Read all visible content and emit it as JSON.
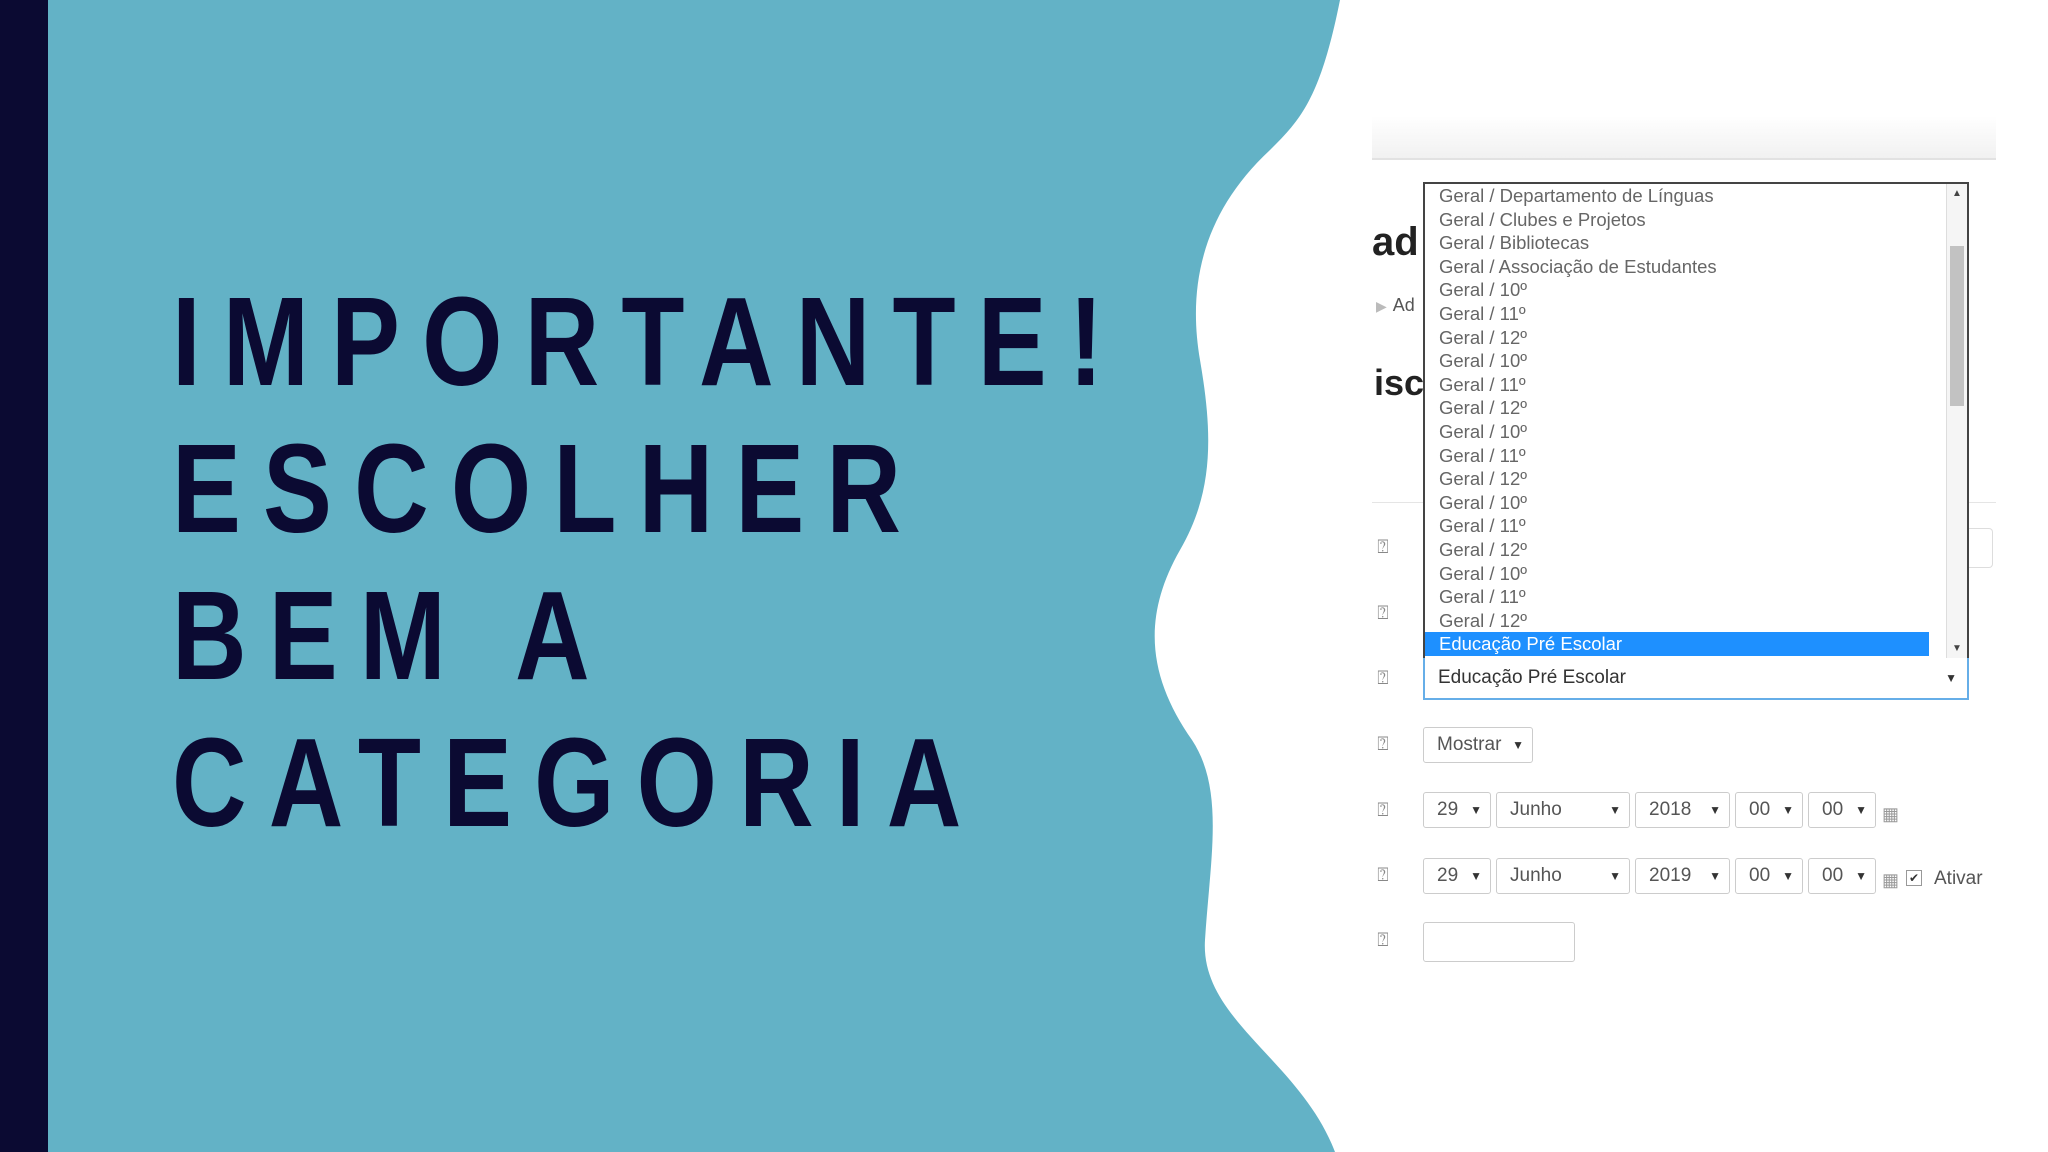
{
  "headline": [
    "IMPORTANTE!",
    "ESCOLHER",
    "BEM A",
    "CATEGORIA"
  ],
  "fragments": {
    "line1": "ad",
    "line2": "isc",
    "breadcrumb": "Ad"
  },
  "category_options": [
    "Geral / Departamento de Línguas",
    "Geral / Clubes e Projetos",
    "Geral / Bibliotecas",
    "Geral / Associação de Estudantes",
    "Geral / 10º",
    "Geral / 11º",
    "Geral / 12º",
    "Geral / 10º",
    "Geral / 11º",
    "Geral / 12º",
    "Geral / 10º",
    "Geral / 11º",
    "Geral / 12º",
    "Geral / 10º",
    "Geral / 11º",
    "Geral / 12º",
    "Geral / 10º",
    "Geral / 11º",
    "Geral / 12º",
    "Educação Pré Escolar"
  ],
  "category_selected": "Educação Pré Escolar",
  "visibility": "Mostrar",
  "start_date": {
    "day": "29",
    "month": "Junho",
    "year": "2018",
    "hour": "00",
    "minute": "00"
  },
  "end_date": {
    "day": "29",
    "month": "Junho",
    "year": "2019",
    "hour": "00",
    "minute": "00"
  },
  "enable_label": "Ativar",
  "icons": {
    "help": "help-icon",
    "calendar": "calendar-icon",
    "dropdown": "chevron-down-icon"
  },
  "colors": {
    "background_teal": "#63b2c6",
    "dark_navy": "#0b0a32",
    "selection_blue": "#1e90ff"
  }
}
